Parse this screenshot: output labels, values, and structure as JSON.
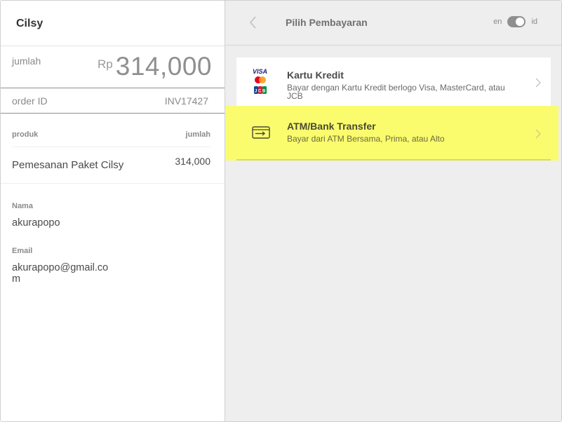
{
  "left": {
    "brand": "Cilsy",
    "amount": {
      "label": "jumlah",
      "currency": "Rp",
      "value": "314,000"
    },
    "order": {
      "label": "order ID",
      "value": "INV17427"
    },
    "products": {
      "header_product": "produk",
      "header_amount": "jumlah",
      "items": [
        {
          "name": "Pemesanan Paket Cilsy",
          "amount": "314,000"
        }
      ]
    },
    "customer": {
      "name_label": "Nama",
      "name_value": "akurapopo",
      "email_label": "Email",
      "email_value": "akurapopo@gmail.com"
    }
  },
  "right": {
    "title": "Pilih Pembayaran",
    "lang_left": "en",
    "lang_right": "id",
    "methods": [
      {
        "title": "Kartu Kredit",
        "desc": "Bayar dengan Kartu Kredit berlogo Visa, MasterCard, atau JCB",
        "icon": "credit-card-logos-icon"
      },
      {
        "title": "ATM/Bank Transfer",
        "desc": "Bayar dari ATM Bersama, Prima, atau Alto",
        "icon": "bank-transfer-icon",
        "highlighted": true
      }
    ]
  },
  "colors": {
    "highlight": "#fafc6e",
    "right_bg": "#eeeeee",
    "toggle": "#8f8f8f"
  }
}
